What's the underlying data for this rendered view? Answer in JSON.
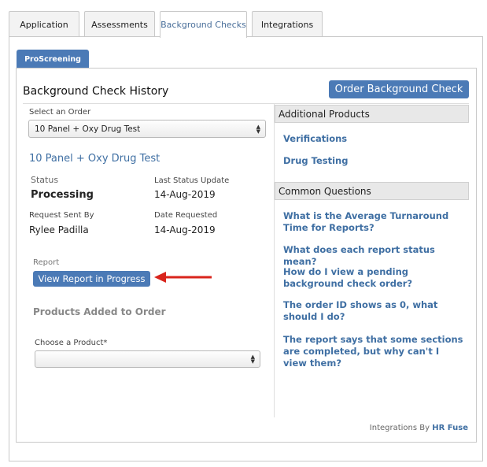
{
  "tabs": [
    {
      "label": "Application"
    },
    {
      "label": "Assessments"
    },
    {
      "label": "Background Checks"
    },
    {
      "label": "Integrations"
    }
  ],
  "subtab": {
    "label": "ProScreening"
  },
  "history": {
    "title": "Background Check History",
    "order_button": "Order Background Check"
  },
  "order_select": {
    "label": "Select an Order",
    "value": "10 Panel + Oxy Drug Test"
  },
  "order": {
    "name": "10 Panel + Oxy Drug Test",
    "status_label": "Status",
    "status_value": "Processing",
    "last_update_label": "Last Status Update",
    "last_update_value": "14-Aug-2019",
    "requested_by_label": "Request Sent By",
    "requested_by_value": "Rylee Padilla",
    "date_requested_label": "Date Requested",
    "date_requested_value": "14-Aug-2019"
  },
  "report": {
    "label": "Report",
    "button": "View Report in Progress"
  },
  "products": {
    "title": "Products Added to Order",
    "choose_label": "Choose a Product*",
    "choose_value": ""
  },
  "additional_products": {
    "header": "Additional Products",
    "items": [
      "Verifications",
      "Drug Testing"
    ]
  },
  "common_questions": {
    "header": "Common Questions",
    "items": [
      "What is the Average Turnaround Time for Reports?",
      "What does each report status mean?",
      "How do I view a pending background check order?",
      "The order ID shows as 0, what should I do?",
      "The report says that some sections are completed, but why can't I view them?"
    ]
  },
  "footer": {
    "prefix": "Integrations By",
    "brand": "HR Fuse"
  },
  "colors": {
    "accent": "#4b7ab6",
    "link": "#3f6fa3",
    "annotation_arrow": "#d9241c"
  }
}
